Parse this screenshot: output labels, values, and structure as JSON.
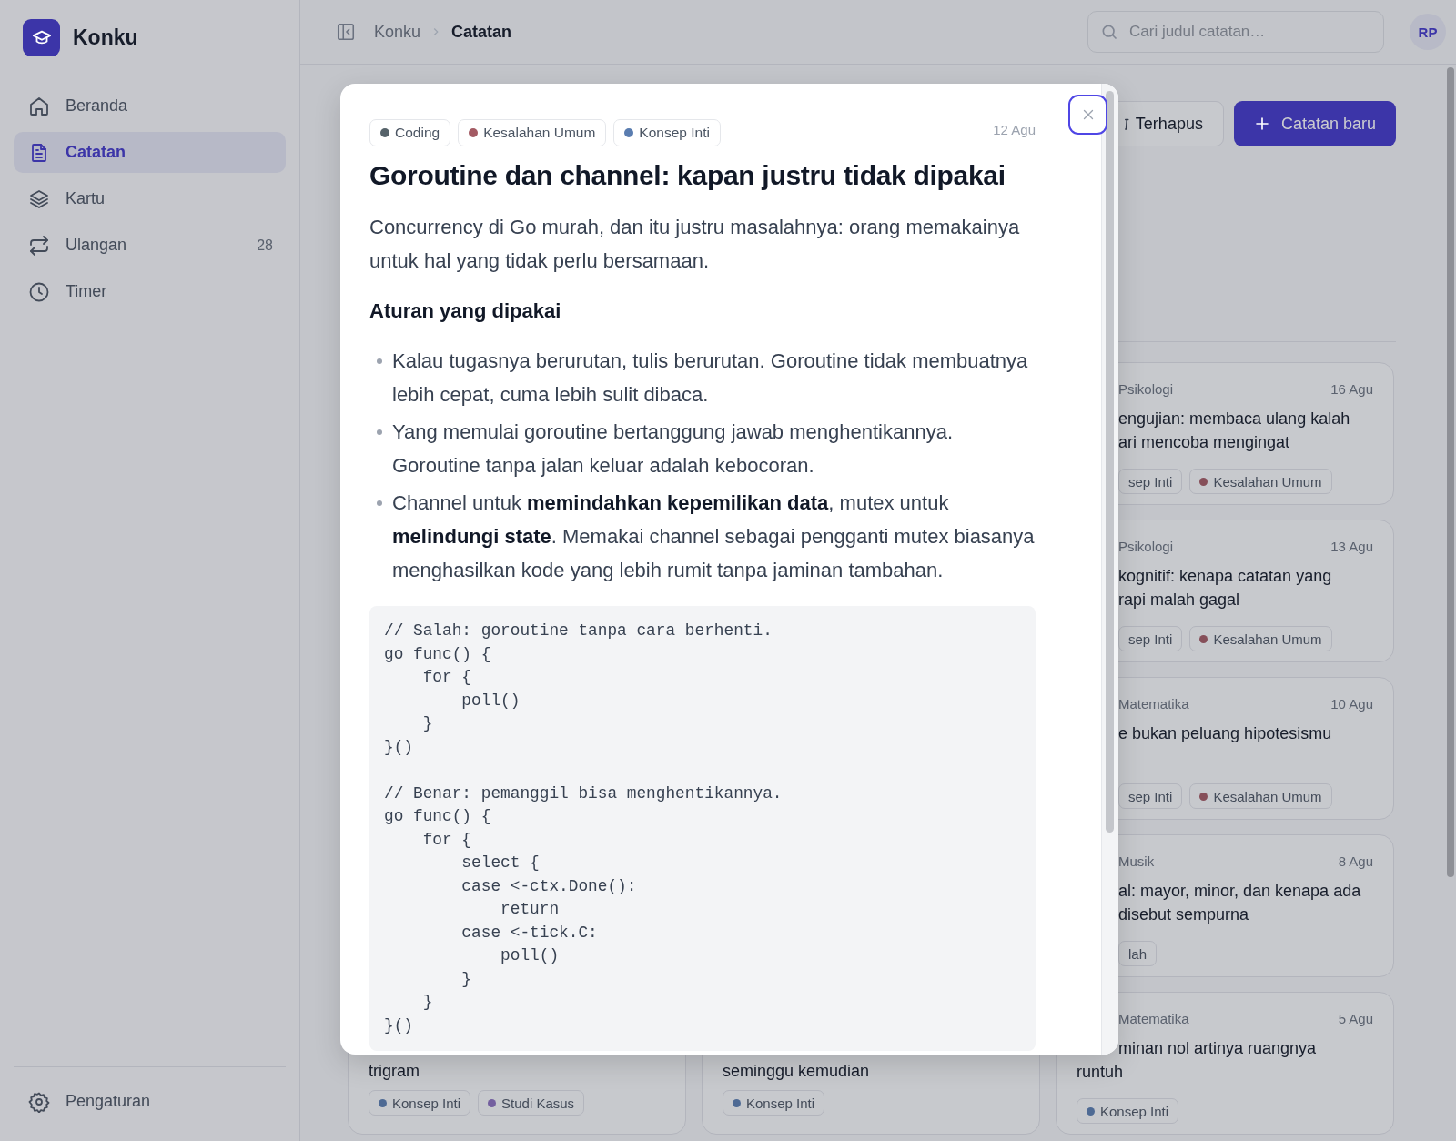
{
  "app": {
    "name": "Konku"
  },
  "sidebar": {
    "items": [
      {
        "label": "Beranda",
        "selected": false
      },
      {
        "label": "Catatan",
        "selected": true
      },
      {
        "label": "Kartu",
        "selected": false
      },
      {
        "label": "Ulangan",
        "selected": false,
        "count": "28"
      },
      {
        "label": "Timer",
        "selected": false
      }
    ],
    "footer": {
      "label": "Pengaturan"
    }
  },
  "header": {
    "breadcrumb": [
      "Konku",
      "Catatan"
    ],
    "search": {
      "placeholder": "Cari judul catatan…"
    },
    "avatar": "RP"
  },
  "toolbar": {
    "buttons": [
      {
        "label": "Terhapus",
        "kind": "secondary"
      },
      {
        "label": "Catatan baru",
        "kind": "primary"
      }
    ]
  },
  "side_cards": [
    {
      "subject": "Psikologi",
      "date": "16 Agu",
      "title_lines": [
        "engujian: membaca ulang kalah",
        "ari mencoba mengingat"
      ],
      "tags": [
        {
          "label": "sep Inti"
        },
        {
          "label": "Kesalahan Umum",
          "color": "#864f59"
        }
      ]
    },
    {
      "subject": "Psikologi",
      "date": "13 Agu",
      "title_lines": [
        "kognitif: kenapa catatan yang",
        "rapi malah gagal"
      ],
      "tags": [
        {
          "label": "sep Inti"
        },
        {
          "label": "Kesalahan Umum",
          "color": "#864f59"
        }
      ]
    },
    {
      "subject": "Matematika",
      "date": "10 Agu",
      "title_lines": [
        "e bukan peluang hipotesismu"
      ],
      "tags": [
        {
          "label": "sep Inti"
        },
        {
          "label": "Kesalahan Umum",
          "color": "#864f59"
        }
      ]
    },
    {
      "subject": "Musik",
      "date": "8 Agu",
      "title_lines": [
        "al: mayor, minor, dan kenapa ada",
        "disebut sempurna"
      ],
      "tags": [
        {
          "label": "lah"
        }
      ]
    },
    {
      "subject": "Matematika",
      "date": "5 Agu",
      "title_lines": [
        "minan nol artinya ruangnya",
        "runtuh"
      ],
      "tags": [
        {
          "label": "Konsep Inti",
          "color": "#4e6a94"
        }
      ]
    }
  ],
  "bottom_cards": [
    {
      "title_lines": [
        "trigram"
      ],
      "tags": [
        {
          "label": "Konsep Inti",
          "color": "#4e6a94"
        },
        {
          "label": "Studi Kasus",
          "color": "#735f9f"
        }
      ]
    },
    {
      "title_lines": [
        "seminggu kemudian"
      ],
      "tags": [
        {
          "label": "Konsep Inti",
          "color": "#4e6a94"
        }
      ]
    }
  ],
  "modal": {
    "tags": [
      {
        "label": "Coding",
        "color": "#56636a"
      },
      {
        "label": "Kesalahan Umum",
        "color": "#a35a63"
      },
      {
        "label": "Konsep Inti",
        "color": "#5a7db0"
      }
    ],
    "date": "12 Agu",
    "title": "Goroutine dan channel: kapan justru tidak dipakai",
    "intro": "Concurrency di Go murah, dan itu justru masalahnya: orang memakainya untuk hal yang tidak perlu bersamaan.",
    "heading": "Aturan yang dipakai",
    "bullets": [
      "Kalau tugasnya berurutan, tulis berurutan. Goroutine tidak membuatnya lebih cepat, cuma lebih sulit dibaca.",
      "Yang memulai goroutine bertanggung jawab menghentikannya. Goroutine tanpa jalan keluar adalah kebocoran.",
      "Channel untuk **memindahkan kepemilikan data**, mutex untuk **melindungi state**. Memakai channel sebagai pengganti mutex biasanya menghasilkan kode yang lebih rumit tanpa jaminan tambahan."
    ],
    "code": "// Salah: goroutine tanpa cara berhenti.\ngo func() {\n    for {\n        poll()\n    }\n}()\n\n// Benar: pemanggil bisa menghentikannya.\ngo func() {\n    for {\n        select {\n        case <-ctx.Done():\n            return\n        case <-tick.C:\n            poll()\n        }\n    }\n}()"
  }
}
